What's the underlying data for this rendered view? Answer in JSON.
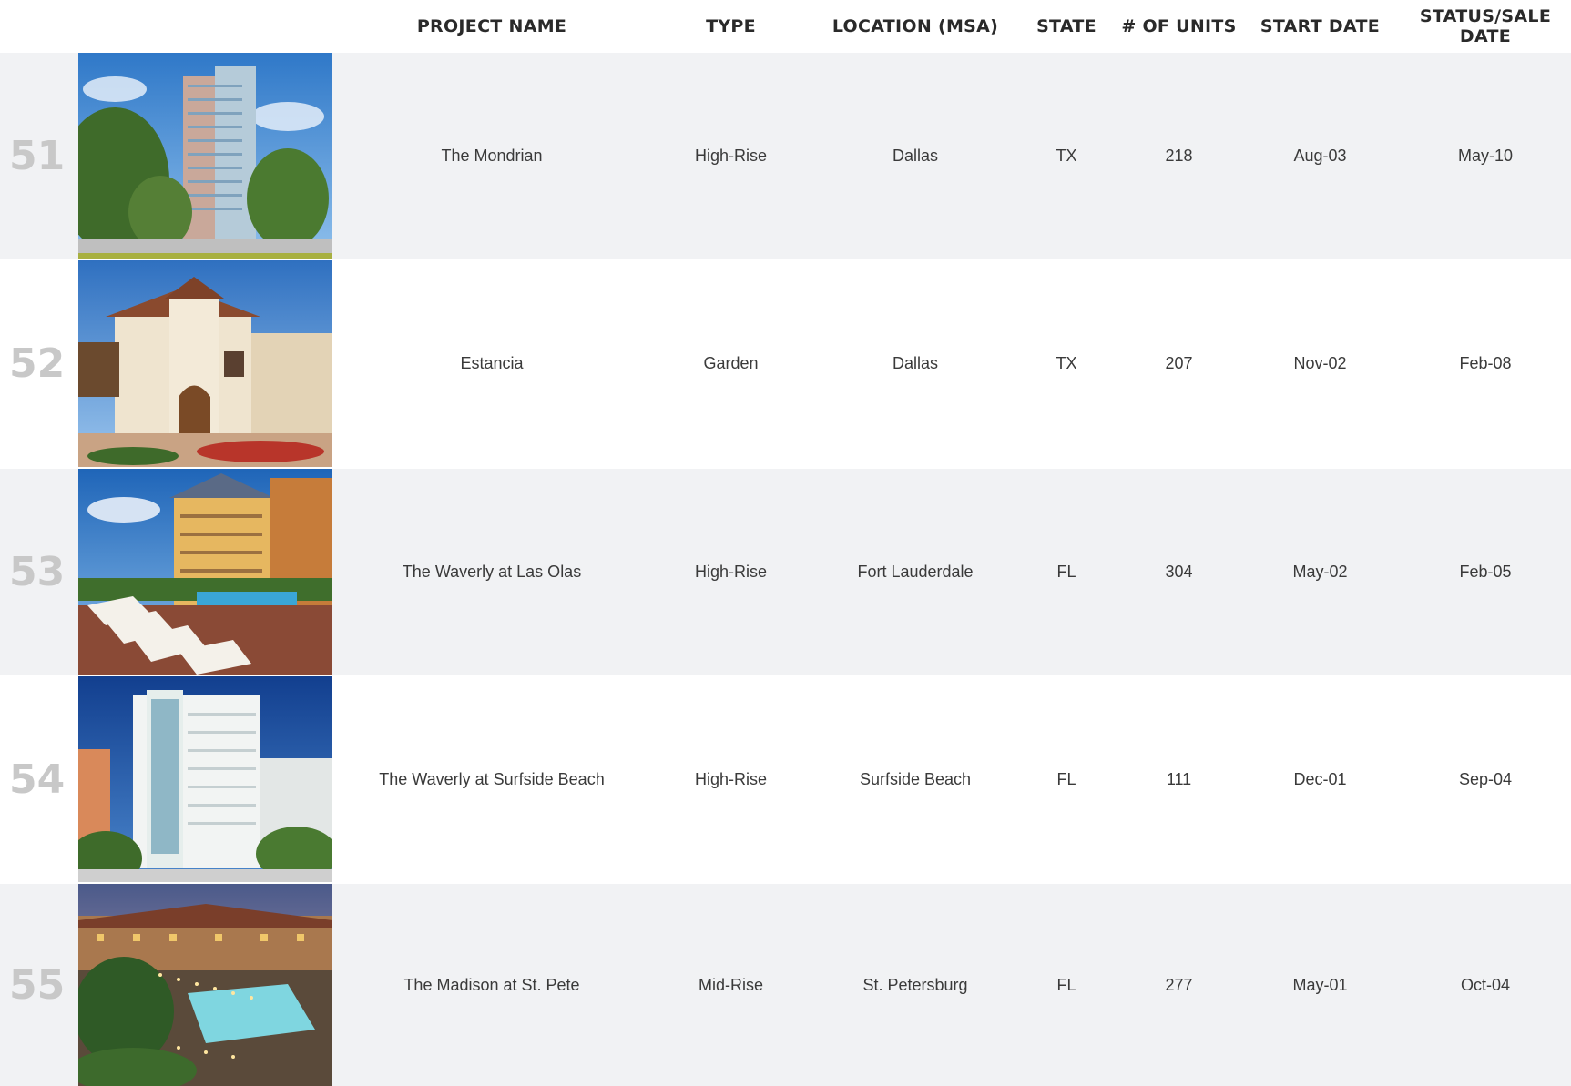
{
  "header": {
    "project_name": "PROJECT NAME",
    "type": "TYPE",
    "location": "LOCATION (MSA)",
    "state": "STATE",
    "units": "# OF UNITS",
    "start_date": "START DATE",
    "status_sale_date": "STATUS/SALE\nDATE"
  },
  "rows": [
    {
      "num": "51",
      "name": "The Mondrian",
      "type": "High-Rise",
      "location": "Dallas",
      "state": "TX",
      "units": "218",
      "start": "Aug-03",
      "status": "May-10",
      "photo": "high-rise-tower-photo"
    },
    {
      "num": "52",
      "name": "Estancia",
      "type": "Garden",
      "location": "Dallas",
      "state": "TX",
      "units": "207",
      "start": "Nov-02",
      "status": "Feb-08",
      "photo": "spanish-villa-photo"
    },
    {
      "num": "53",
      "name": "The Waverly at Las Olas",
      "type": "High-Rise",
      "location": "Fort Lauderdale",
      "state": "FL",
      "units": "304",
      "start": "May-02",
      "status": "Feb-05",
      "photo": "pool-deck-photo"
    },
    {
      "num": "54",
      "name": "The Waverly at Surfside Beach",
      "type": "High-Rise",
      "location": "Surfside Beach",
      "state": "FL",
      "units": "111",
      "start": "Dec-01",
      "status": "Sep-04",
      "photo": "white-tower-photo"
    },
    {
      "num": "55",
      "name": "The Madison at St. Pete",
      "type": "Mid-Rise",
      "location": "St. Petersburg",
      "state": "FL",
      "units": "277",
      "start": "May-01",
      "status": "Oct-04",
      "photo": "courtyard-pool-photo"
    }
  ]
}
